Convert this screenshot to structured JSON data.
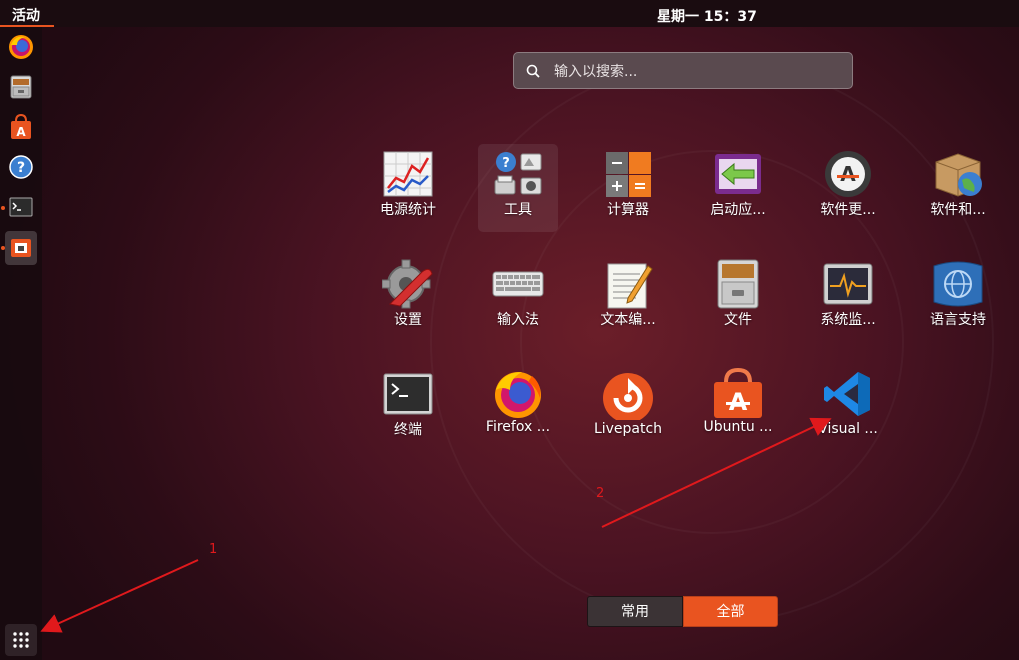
{
  "topbar": {
    "activities": "活动",
    "clock": "星期一 15：37"
  },
  "search": {
    "placeholder": "输入以搜索..."
  },
  "dock": {
    "items": [
      {
        "name": "Firefox",
        "icon": "firefox-icon"
      },
      {
        "name": "Files cabinet",
        "icon": "file-cabinet-icon"
      },
      {
        "name": "Ubuntu Software",
        "icon": "software-bag-icon"
      },
      {
        "name": "Help",
        "icon": "help-icon"
      },
      {
        "name": "Terminal",
        "icon": "terminal-icon"
      },
      {
        "name": "Screenshot",
        "icon": "screenshot-icon"
      }
    ],
    "show_apps_icon": "grid-icon"
  },
  "apps": [
    {
      "label": "电源统计",
      "icon": "power-statistics-icon"
    },
    {
      "label": "工具",
      "icon": "tools-folder-icon"
    },
    {
      "label": "计算器",
      "icon": "calculator-icon"
    },
    {
      "label": "启动应...",
      "icon": "startup-apps-icon"
    },
    {
      "label": "软件更...",
      "icon": "software-updater-icon"
    },
    {
      "label": "软件和...",
      "icon": "software-sources-icon"
    },
    {
      "label": "设置",
      "icon": "settings-icon"
    },
    {
      "label": "输入法",
      "icon": "keyboard-icon"
    },
    {
      "label": "文本编...",
      "icon": "text-editor-icon"
    },
    {
      "label": "文件",
      "icon": "files-icon"
    },
    {
      "label": "系统监...",
      "icon": "system-monitor-icon"
    },
    {
      "label": "语言支持",
      "icon": "language-support-icon"
    },
    {
      "label": "终端",
      "icon": "terminal-icon"
    },
    {
      "label": "Firefox ...",
      "icon": "firefox-icon"
    },
    {
      "label": "Livepatch",
      "icon": "livepatch-icon"
    },
    {
      "label": "Ubuntu ...",
      "icon": "ubuntu-software-icon"
    },
    {
      "label": "Visual ...",
      "icon": "vscode-icon"
    }
  ],
  "view_switch": {
    "frequent": "常用",
    "all": "全部"
  },
  "annotations": {
    "one": "1",
    "two": "2"
  },
  "colors": {
    "accent": "#e95420",
    "annotation": "#e0191c"
  }
}
